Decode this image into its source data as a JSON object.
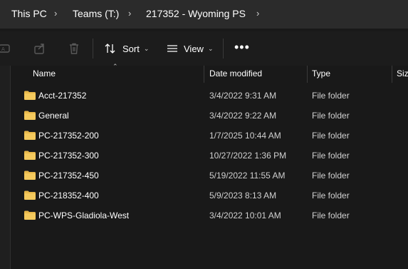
{
  "breadcrumb": {
    "items": [
      "This PC",
      "Teams (T:)",
      "217352 - Wyoming PS"
    ],
    "separator": "›"
  },
  "toolbar": {
    "icons": [
      "rename-icon",
      "share-icon",
      "delete-icon"
    ],
    "sort_label": "Sort",
    "view_label": "View",
    "more_label": "•••"
  },
  "columns": {
    "name": "Name",
    "date_modified": "Date modified",
    "type": "Type",
    "size": "Siz"
  },
  "rows": [
    {
      "name": "Acct-217352",
      "date": "3/4/2022 9:31 AM",
      "type": "File folder"
    },
    {
      "name": "General",
      "date": "3/4/2022 9:22 AM",
      "type": "File folder"
    },
    {
      "name": "PC-217352-200",
      "date": "1/7/2025 10:44 AM",
      "type": "File folder"
    },
    {
      "name": "PC-217352-300",
      "date": "10/27/2022 1:36 PM",
      "type": "File folder"
    },
    {
      "name": "PC-217352-450",
      "date": "5/19/2022 11:55 AM",
      "type": "File folder"
    },
    {
      "name": "PC-218352-400",
      "date": "5/9/2023 8:13 AM",
      "type": "File folder"
    },
    {
      "name": "PC-WPS-Gladiola-West",
      "date": "3/4/2022 10:01 AM",
      "type": "File folder"
    }
  ],
  "colors": {
    "background": "#191919",
    "breadcrumb_bar": "#2b2b2b",
    "folder": "#e8b84a"
  }
}
